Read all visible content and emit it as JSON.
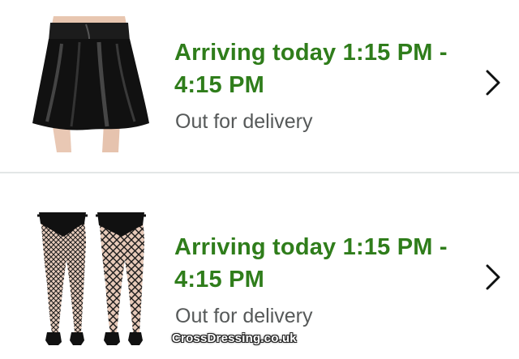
{
  "orders": [
    {
      "status": "Arriving today 1:15 PM - 4:15 PM",
      "status_line1": "Arriving today 1:15 PM -",
      "status_line2": "4:15 PM",
      "substatus": "Out for delivery",
      "product_image": "black-faux-leather-skater-skirt",
      "action_icon": "chevron-right-icon"
    },
    {
      "status": "Arriving today 1:15 PM - 4:15 PM",
      "status_line1": "Arriving today 1:15 PM -",
      "status_line2": "4:15 PM",
      "substatus": "Out for delivery",
      "product_image": "black-fishnet-tights",
      "action_icon": "chevron-right-icon"
    }
  ],
  "watermark": "CrossDressing.co.uk",
  "colors": {
    "status_green": "#2f7d1b",
    "substatus_gray": "#565959",
    "divider": "#e3e6e6",
    "chevron": "#0f1111"
  }
}
